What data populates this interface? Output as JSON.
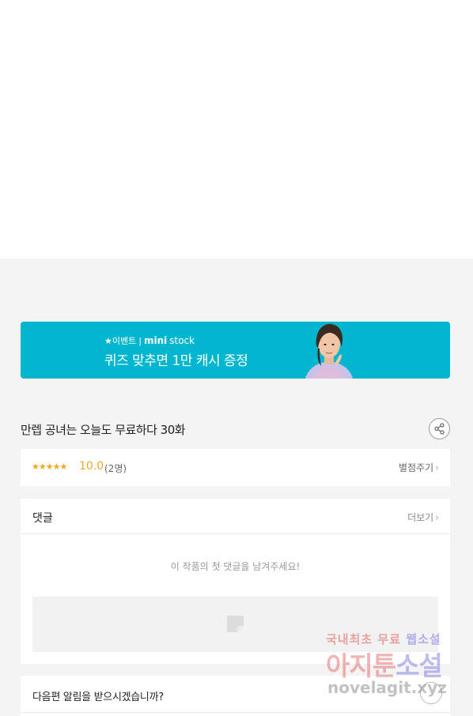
{
  "banner": {
    "tag_star": "★이벤트",
    "tag_sep": "|",
    "brand_mini": "mini",
    "brand_stock": "stock",
    "title": "퀴즈 맞추면 1만 캐시 증정"
  },
  "episode": {
    "title": "만렙 공녀는 오늘도 무료하다 30화"
  },
  "rating": {
    "stars": "★★★★★",
    "score": "10.0",
    "count": "(2명)",
    "rate_label": "별점주기"
  },
  "comments": {
    "label": "댓글",
    "more_label": "더보기",
    "empty_message": "이 작품의 첫 댓글을 남겨주세요!"
  },
  "notify": {
    "text": "다음편 알림을 받으시겠습니까?"
  },
  "watermark": {
    "line1_a": "국내최초 무료",
    "line1_b": "웹소설",
    "line2_a": "아지툰",
    "line2_b": "소설",
    "line3": "novelagit.xyz"
  },
  "colors": {
    "banner_bg": "#02b6cf",
    "star": "#f5a623",
    "page_bg": "#f4f4f4"
  },
  "icons": {
    "share": "share-icon",
    "chevron": "chevron-right-icon",
    "comment_placeholder": "comment-placeholder-icon"
  }
}
